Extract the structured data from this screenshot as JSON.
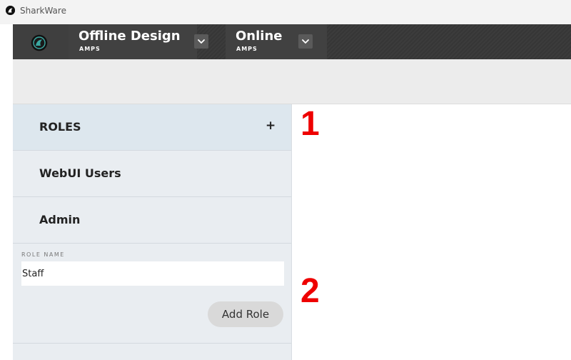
{
  "window": {
    "title": "SharkWare",
    "icon": "sharkware-logo-icon"
  },
  "topnav": {
    "logo_icon": "sharkware-logo-icon",
    "tabs": [
      {
        "title": "Offline Design",
        "subtitle": "AMPS",
        "dropdown_icon": "chevron-down-icon"
      },
      {
        "title": "Online",
        "subtitle": "AMPS",
        "dropdown_icon": "chevron-down-icon"
      }
    ]
  },
  "sidebar": {
    "header": {
      "label": "ROLES",
      "add_symbol": "+"
    },
    "items": [
      {
        "label": "WebUI Users"
      },
      {
        "label": "Admin"
      }
    ],
    "form": {
      "field_label": "ROLE NAME",
      "field_value": "Staff",
      "button_label": "Add Role"
    }
  },
  "annotations": {
    "marker1": "1",
    "marker2": "2"
  },
  "colors": {
    "nav_background": "#3a3a3a",
    "sidebar_background": "#e9edf1",
    "annotation": "#ee0000"
  }
}
